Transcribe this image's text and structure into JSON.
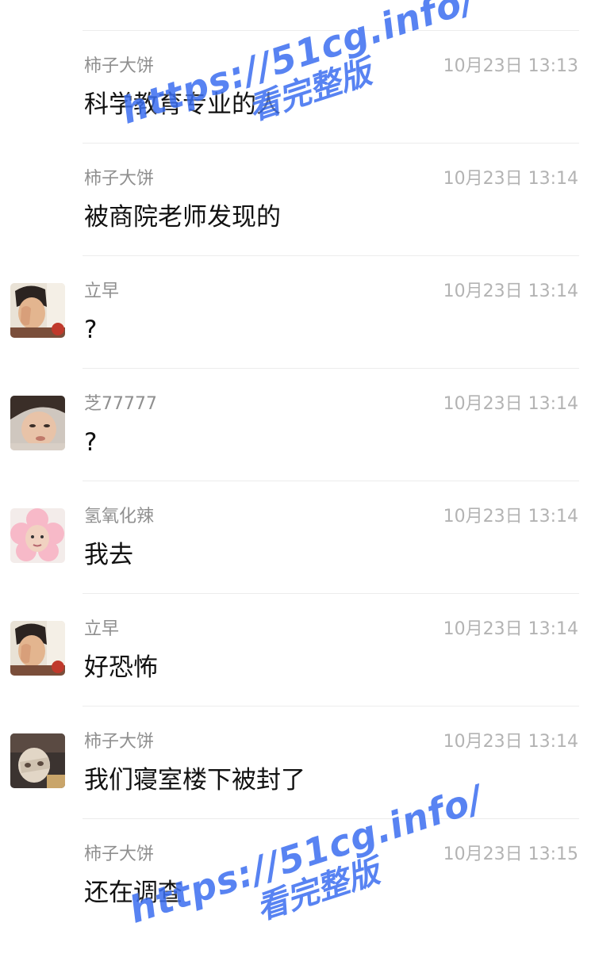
{
  "messages": [
    {
      "sender": "柿子大饼",
      "time": "10月23日 13:13",
      "text": "科学教育专业的人",
      "avatar": "none"
    },
    {
      "sender": "柿子大饼",
      "time": "10月23日 13:14",
      "text": "被商院老师发现的",
      "avatar": "none"
    },
    {
      "sender": "立早",
      "time": "10月23日 13:14",
      "text": "?",
      "avatar": "lizao-avatar"
    },
    {
      "sender": "芝77777",
      "time": "10月23日 13:14",
      "text": "?",
      "avatar": "zhi-avatar"
    },
    {
      "sender": "氢氧化辣",
      "time": "10月23日 13:14",
      "text": "我去",
      "avatar": "flower-avatar"
    },
    {
      "sender": "立早",
      "time": "10月23日 13:14",
      "text": "好恐怖",
      "avatar": "lizao-avatar"
    },
    {
      "sender": "柿子大饼",
      "time": "10月23日 13:14",
      "text": "我们寝室楼下被封了",
      "avatar": "shizi-avatar"
    },
    {
      "sender": "柿子大饼",
      "time": "10月23日 13:15",
      "text": "还在调查",
      "avatar": "none"
    }
  ],
  "watermarks": [
    {
      "url": "https://51cg.info/",
      "sub": "看完整版"
    },
    {
      "url": "https://51cg.info/",
      "sub": "看完整版"
    }
  ]
}
